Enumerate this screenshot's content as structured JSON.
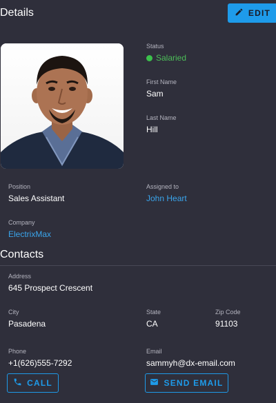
{
  "details": {
    "title": "Details",
    "edit_label": "EDIT",
    "status_label": "Status",
    "status_value": "Salaried",
    "status_color": "#3cc14c",
    "first_name_label": "First Name",
    "first_name": "Sam",
    "last_name_label": "Last Name",
    "last_name": "Hill",
    "position_label": "Position",
    "position": "Sales Assistant",
    "assigned_label": "Assigned to",
    "assigned": "John Heart",
    "company_label": "Company",
    "company": "ElectrixMax",
    "photo_icon": "person-photo"
  },
  "contacts": {
    "title": "Contacts",
    "address_label": "Address",
    "address": "645 Prospect Crescent",
    "city_label": "City",
    "city": "Pasadena",
    "state_label": "State",
    "state": "CA",
    "zip_label": "Zip Code",
    "zip": "91103",
    "phone_label": "Phone",
    "phone": "+1(626)555-7292",
    "email_label": "Email",
    "email": "sammyh@dx-email.com",
    "call_label": "CALL",
    "send_email_label": "SEND EMAIL",
    "call_icon": "phone-icon",
    "email_icon": "envelope-icon"
  },
  "colors": {
    "background": "#2f2f3b",
    "accent": "#1e9bea",
    "link": "#3aa5ec"
  }
}
